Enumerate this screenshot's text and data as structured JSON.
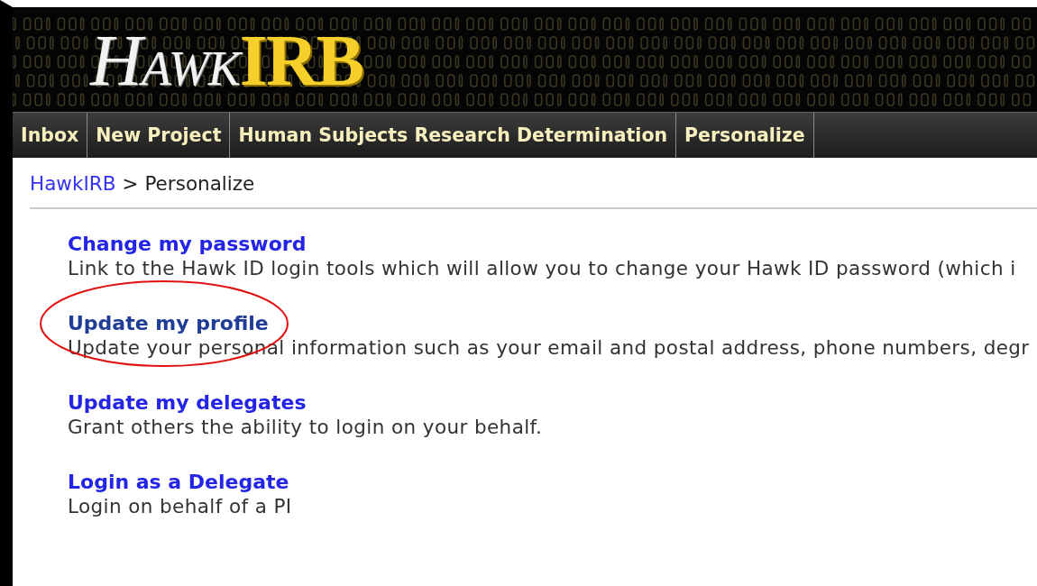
{
  "logo": {
    "first": "HAWK",
    "second": "IRB"
  },
  "nav": [
    {
      "label": "Inbox"
    },
    {
      "label": "New Project"
    },
    {
      "label": "Human Subjects Research Determination"
    },
    {
      "label": "Personalize"
    }
  ],
  "breadcrumb": {
    "link": "HawkIRB",
    "separator": ">",
    "current": "Personalize"
  },
  "items": [
    {
      "title": "Change my password",
      "description": "Link to the Hawk ID login tools which will allow you to change your Hawk ID password (which i",
      "visited": false,
      "circled": false
    },
    {
      "title": "Update my profile",
      "description": "Update your personal information such as your email and postal address, phone numbers, degr",
      "visited": true,
      "circled": true
    },
    {
      "title": "Update my delegates",
      "description": "Grant others the ability to login on your behalf.",
      "visited": false,
      "circled": false
    },
    {
      "title": "Login as a Delegate",
      "description": "Login on behalf of a PI",
      "visited": false,
      "circled": false
    }
  ]
}
